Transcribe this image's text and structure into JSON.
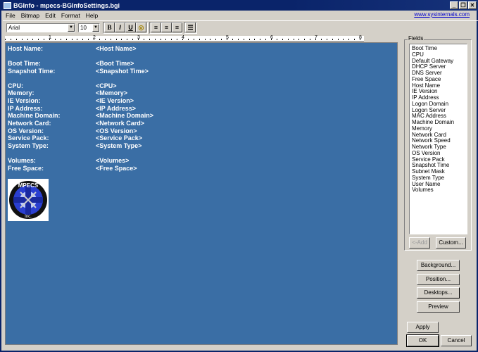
{
  "window": {
    "title": "BGInfo - mpecs-BGInfoSettings.bgi",
    "controls": [
      "_",
      "❐",
      "✕"
    ]
  },
  "menu": [
    "File",
    "Bitmap",
    "Edit",
    "Format",
    "Help"
  ],
  "link": "www.sysinternals.com",
  "toolbar": {
    "font": "Arial",
    "size": "10",
    "bold": "B",
    "italic": "I",
    "underline": "U"
  },
  "ruler": [
    "1",
    "2",
    "3",
    "4",
    "5",
    "6",
    "7",
    "8"
  ],
  "editor": {
    "background": "#3a6ea5",
    "rows": [
      {
        "label": "Host Name:",
        "value": "<Host Name>"
      },
      {
        "label": "Boot Time:",
        "value": "<Boot Time>"
      },
      {
        "label": "Snapshot Time:",
        "value": "<Snapshot Time>"
      },
      {
        "label": "CPU:",
        "value": "<CPU>"
      },
      {
        "label": "Memory:",
        "value": "<Memory>"
      },
      {
        "label": "IE Version:",
        "value": "<IE Version>"
      },
      {
        "label": "IP Address:",
        "value": "<IP Address>"
      },
      {
        "label": "Machine Domain:",
        "value": "<Machine Domain>"
      },
      {
        "label": "Network Card:",
        "value": "<Network Card>"
      },
      {
        "label": "OS Version:",
        "value": "<OS Version>"
      },
      {
        "label": "Service Pack:",
        "value": "<Service Pack>"
      },
      {
        "label": "System Type:",
        "value": "<System Type>"
      },
      {
        "label": "Volumes:",
        "value": "<Volumes>"
      },
      {
        "label": "Free Space:",
        "value": "<Free Space>"
      }
    ],
    "logo_text": [
      "MPECS",
      "Inc."
    ]
  },
  "fields": {
    "label": "Fields",
    "items": [
      "Boot Time",
      "CPU",
      "Default Gateway",
      "DHCP Server",
      "DNS Server",
      "Free Space",
      "Host Name",
      "IE Version",
      "IP Address",
      "Logon Domain",
      "Logon Server",
      "MAC Address",
      "Machine Domain",
      "Memory",
      "Network Card",
      "Network Speed",
      "Network Type",
      "OS Version",
      "Service Pack",
      "Snapshot Time",
      "Subnet Mask",
      "System Type",
      "User Name",
      "Volumes"
    ],
    "add": "<-Add",
    "custom": "Custom..."
  },
  "buttons": {
    "background": "Background...",
    "position": "Position...",
    "desktops": "Desktops...",
    "preview": "Preview",
    "apply": "Apply",
    "ok": "OK",
    "cancel": "Cancel"
  }
}
